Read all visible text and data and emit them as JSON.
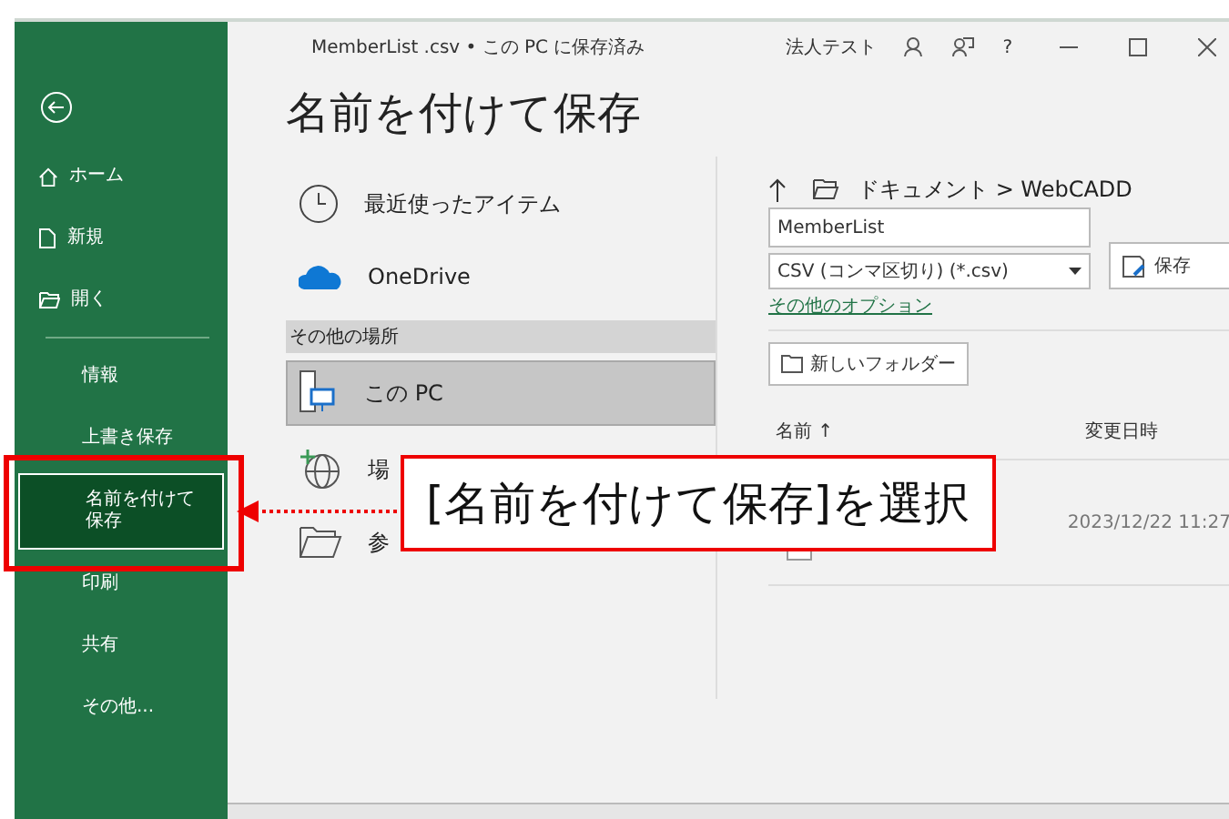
{
  "window": {
    "title": "MemberList .csv • この PC に保存済み",
    "user": "法人テスト",
    "help": "?"
  },
  "sidebar": {
    "items": [
      {
        "label": "ホーム",
        "kind": "main",
        "selected": false
      },
      {
        "label": "新規",
        "kind": "main",
        "selected": false
      },
      {
        "label": "開く",
        "kind": "main",
        "selected": false
      },
      {
        "label": "情報",
        "kind": "sub",
        "selected": false
      },
      {
        "label": "上書き保存",
        "kind": "sub",
        "selected": false
      },
      {
        "label": "名前を付けて保存",
        "kind": "sub",
        "selected": true
      },
      {
        "label": "印刷",
        "kind": "sub",
        "selected": false
      },
      {
        "label": "共有",
        "kind": "sub",
        "selected": false
      },
      {
        "label": "その他...",
        "kind": "sub",
        "selected": false
      }
    ]
  },
  "heading": "名前を付けて保存",
  "places": {
    "items": [
      {
        "label": "最近使ったアイテム",
        "selected": false
      },
      {
        "label": "OneDrive",
        "selected": false
      }
    ],
    "section": "その他の場所",
    "other": [
      {
        "label": "この PC",
        "selected": true
      },
      {
        "label": "場",
        "selected": false
      },
      {
        "label": "参",
        "selected": false
      }
    ]
  },
  "save": {
    "path": "ドキュメント > WebCADD",
    "filename": "MemberList",
    "filetype": "CSV (コンマ区切り) (*.csv)",
    "save_button": "保存",
    "more_options": "その他のオプション",
    "new_folder": "新しいフォルダー",
    "columns": [
      "名前 ↑",
      "変更日時"
    ],
    "rows": [
      {
        "modified": "2023/12/22 11:27"
      }
    ]
  },
  "callout": "[名前を付けて保存]を選択"
}
